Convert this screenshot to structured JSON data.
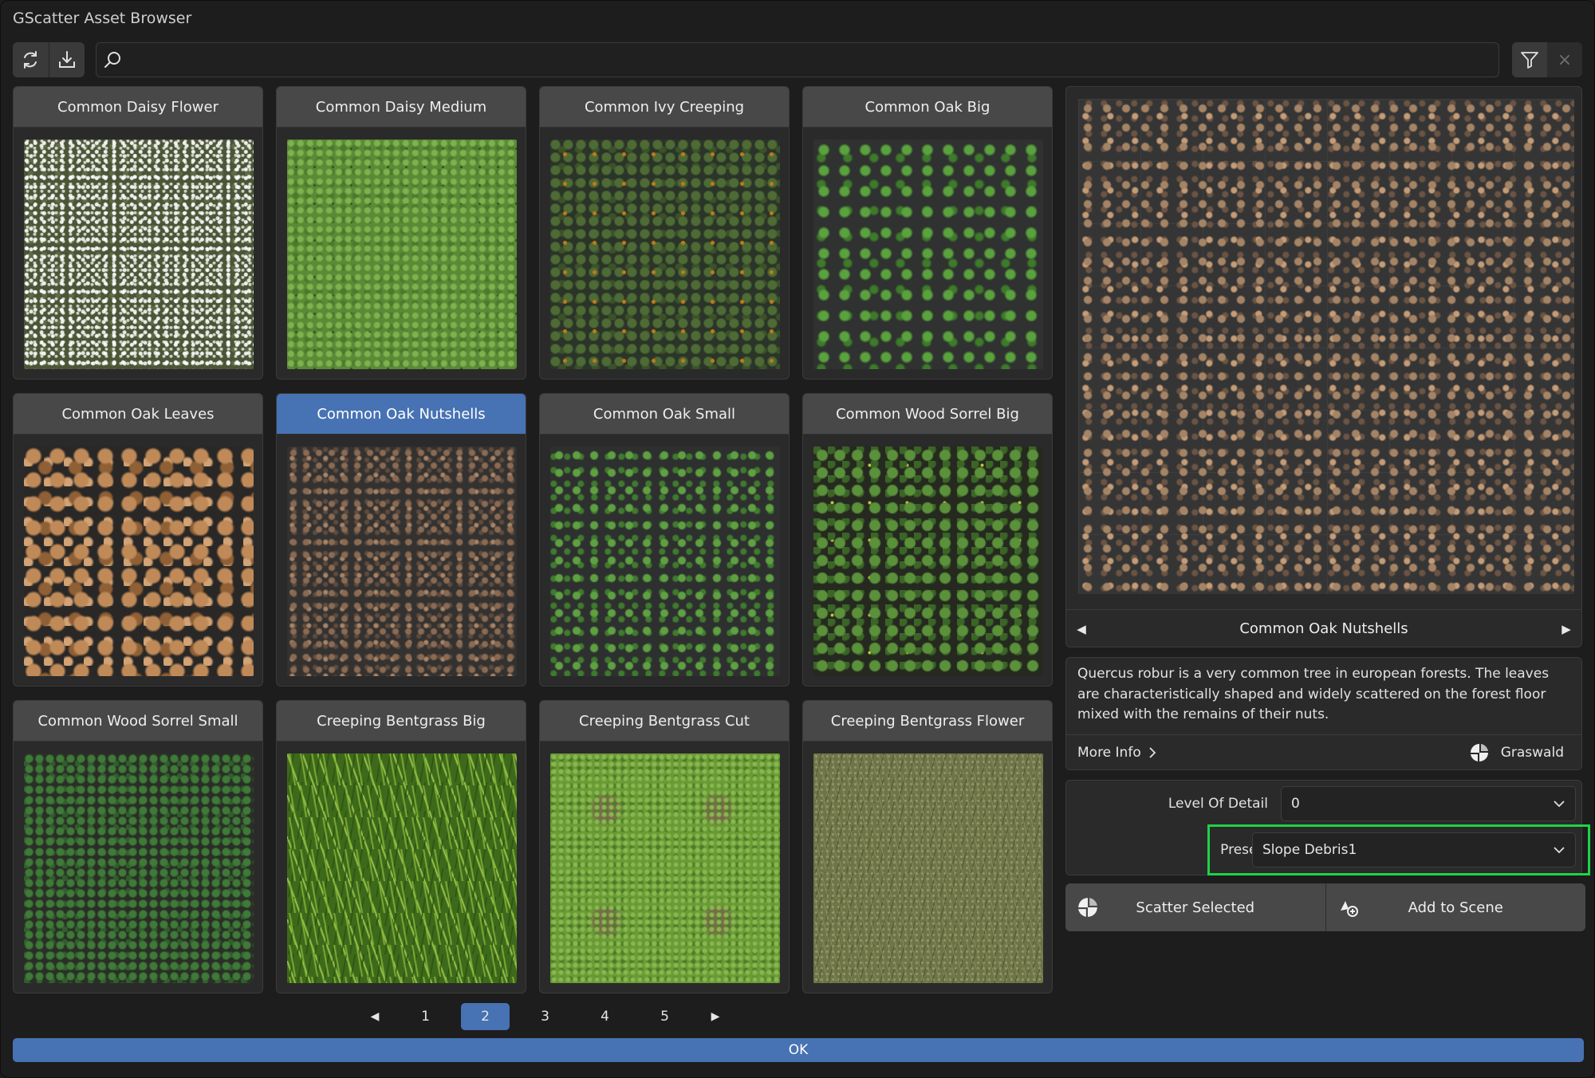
{
  "window": {
    "title": "GScatter Asset Browser"
  },
  "toolbar": {
    "search_placeholder": "",
    "icons": [
      "refresh-icon",
      "download-icon",
      "search-icon",
      "filter-icon",
      "close-icon"
    ]
  },
  "grid": {
    "cards": [
      {
        "label": "Common Daisy Flower"
      },
      {
        "label": "Common Daisy Medium"
      },
      {
        "label": "Common Ivy Creeping"
      },
      {
        "label": "Common Oak Big"
      },
      {
        "label": "Common Oak Leaves"
      },
      {
        "label": "Common Oak Nutshells",
        "selected": true
      },
      {
        "label": "Common Oak Small"
      },
      {
        "label": "Common Wood Sorrel Big"
      },
      {
        "label": "Common Wood Sorrel Small"
      },
      {
        "label": "Creeping Bentgrass Big"
      },
      {
        "label": "Creeping Bentgrass Cut"
      },
      {
        "label": "Creeping Bentgrass Flower"
      }
    ]
  },
  "preview": {
    "name": "Common Oak Nutshells",
    "description": "Quercus robur is a very common tree in european forests. The leaves are characteristically shaped and widely scattered on the forest floor mixed with the remains of their nuts.",
    "more_info": "More Info",
    "author": "Graswald"
  },
  "settings": {
    "lod_label": "Level Of Detail",
    "lod_value": "0",
    "presets_label": "Presets",
    "presets_value": "Slope Debris1"
  },
  "actions": {
    "scatter_selected": "Scatter Selected",
    "add_to_scene": "Add to Scene"
  },
  "pagination": {
    "pages": [
      "1",
      "2",
      "3",
      "4",
      "5"
    ],
    "current": "2"
  },
  "footer": {
    "ok": "OK"
  },
  "colors": {
    "accent": "#4772b3",
    "highlight": "#1fd247",
    "background": "#1d1d1d"
  }
}
